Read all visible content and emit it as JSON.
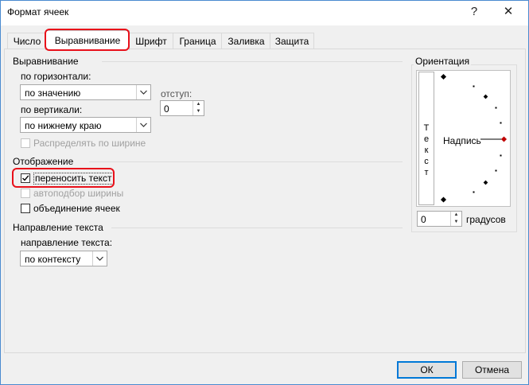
{
  "window": {
    "title": "Формат ячеек",
    "help": "?",
    "close": "✕"
  },
  "tabs": [
    {
      "label": "Число"
    },
    {
      "label": "Выравнивание"
    },
    {
      "label": "Шрифт"
    },
    {
      "label": "Граница"
    },
    {
      "label": "Заливка"
    },
    {
      "label": "Защита"
    }
  ],
  "alignment": {
    "group": "Выравнивание",
    "horizontal_label": "по горизонтали:",
    "horizontal_value": "по значению",
    "indent_label": "отступ:",
    "indent_value": "0",
    "vertical_label": "по вертикали:",
    "vertical_value": "по нижнему краю",
    "distribute_label": "Распределять по ширине"
  },
  "display": {
    "group": "Отображение",
    "wrap_label": "переносить текст",
    "wrap_checked": true,
    "shrink_label": "автоподбор ширины",
    "merge_label": "объединение ячеек"
  },
  "direction": {
    "group": "Направление текста",
    "label": "направление текста:",
    "value": "по контексту"
  },
  "orientation": {
    "group": "Ориентация",
    "vertical_text": [
      "Т",
      "е",
      "к",
      "с",
      "т"
    ],
    "caption": "Надпись",
    "degrees_value": "0",
    "degrees_label": "градусов",
    "marker_color": "#c00000"
  },
  "buttons": {
    "ok": "ОК",
    "cancel": "Отмена"
  },
  "highlight_color": "#e8101a"
}
